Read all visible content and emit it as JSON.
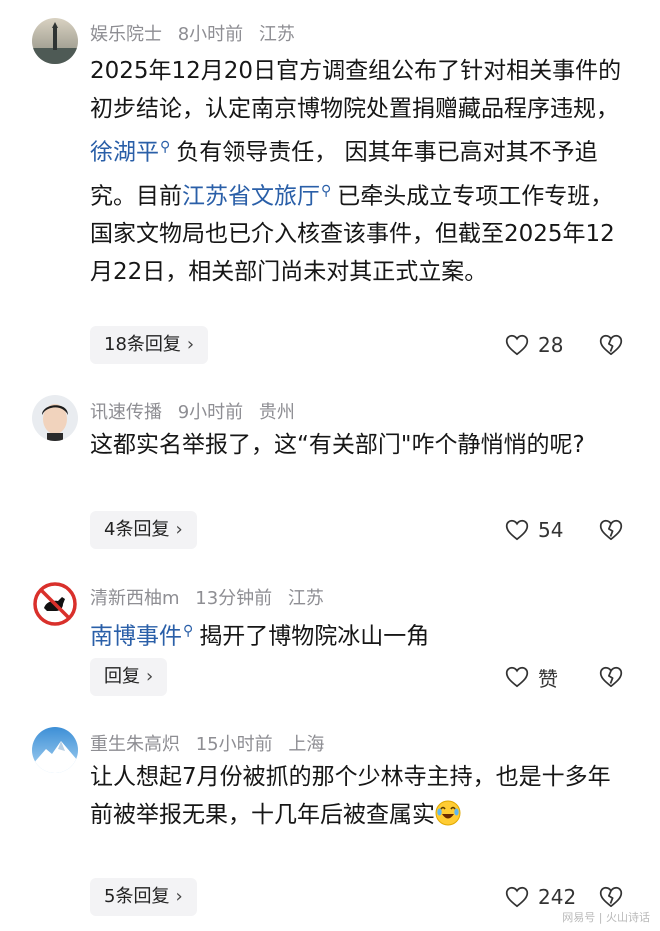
{
  "comments": [
    {
      "user": "娱乐院士",
      "time": "8小时前",
      "location": "江苏",
      "text_1": "2025年12月20日官方调查组公布了针对相关事件的初步结论，认定南京博物院处置捐赠藏品程序违规，",
      "link_1": "徐湖平",
      "text_2": "负有领导责任，  因其年事已高对其不予追究。目前",
      "link_2": "江苏省文旅厅",
      "text_3": "已牵头成立专项工作专班，国家文物局也已介入核查该事件，但截至2025年12月22日，相关部门尚未对其正式立案。",
      "replies": "18条回复",
      "likes": "28"
    },
    {
      "user": "讯速传播",
      "time": "9小时前",
      "location": "贵州",
      "text_1": "这都实名举报了，这“有关部门\"咋个静悄悄的呢?",
      "replies": "4条回复",
      "likes": "54"
    },
    {
      "user": "清新西柚m",
      "time": "13分钟前",
      "location": "江苏",
      "link_1": "南博事件",
      "text_1": "揭开了博物院冰山一角",
      "replies": "回复",
      "likes": "赞"
    },
    {
      "user": "重生朱高炽",
      "time": "15小时前",
      "location": "上海",
      "text_1": "让人想起7月份被抓的那个少林寺主持，也是十多年前被举报无果，十几年后被查属实",
      "replies": "5条回复",
      "likes": "242"
    }
  ],
  "icons": {
    "search_glyph": "⚲",
    "chevron": "›"
  },
  "colors": {
    "link": "#2a5fa8",
    "meta": "#8e8e93",
    "button_bg": "#f3f3f5"
  },
  "watermark": "网易号 | 火山诗话"
}
